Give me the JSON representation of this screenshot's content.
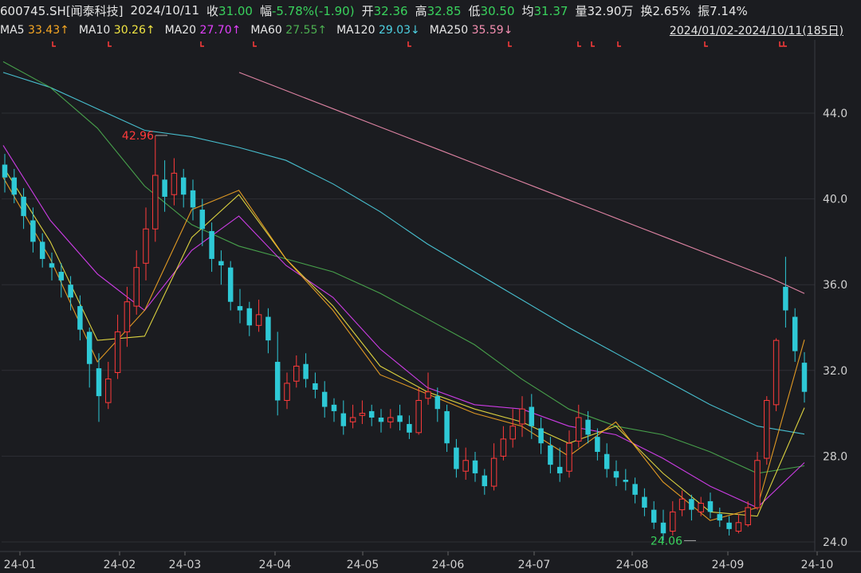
{
  "header": {
    "symbol": "600745.SH[闻泰科技]",
    "date": "2024/10/11",
    "close_label": "收",
    "close_value": "31.00",
    "change_label": "幅",
    "change_value": "-5.78%(-1.90)",
    "open_label": "开",
    "open_value": "32.36",
    "high_label": "高",
    "high_value": "32.85",
    "low_label": "低",
    "low_value": "30.50",
    "avg_label": "均",
    "avg_value": "31.37",
    "volume_label": "量",
    "volume_value": "32.90万",
    "turnover_label": "换",
    "turnover_value": "2.65%",
    "amplitude_label": "振",
    "amplitude_value": "7.14%"
  },
  "ma_legend": [
    {
      "label": "MA5",
      "value": "33.43↑",
      "color": "#f5a623"
    },
    {
      "label": "MA10",
      "value": "30.26↑",
      "color": "#f0e442"
    },
    {
      "label": "MA20",
      "value": "27.70↑",
      "color": "#e040fb"
    },
    {
      "label": "MA60",
      "value": "27.55↑",
      "color": "#4caf50"
    },
    {
      "label": "MA120",
      "value": "29.03↓",
      "color": "#4dd0e1"
    },
    {
      "label": "MA250",
      "value": "35.59↓",
      "color": "#f48fb1"
    }
  ],
  "date_range": "2024/01/02-2024/10/11(185日)",
  "colors": {
    "up": "#ff3b3b",
    "down": "#2ec9d6",
    "bg": "#1b1c20",
    "grid": "#2e2f35"
  },
  "chart_data": {
    "type": "candlestick",
    "title": "",
    "y_ticks": [
      "24.0",
      "28.0",
      "32.0",
      "36.0",
      "40.0",
      "44.0"
    ],
    "ylim": [
      23.5,
      47.0
    ],
    "x_ticks": [
      "24-01",
      "24-02",
      "24-03",
      "24-04",
      "24-05",
      "24-06",
      "24-07",
      "24-08",
      "24-09",
      "24-10"
    ],
    "annotations": [
      {
        "text": "42.96",
        "x": "24-03",
        "y": 42.96
      },
      {
        "text": "24.06",
        "x": "24-09",
        "y": 24.06
      }
    ],
    "moving_averages": [
      {
        "name": "MA250",
        "values": [
          45.9,
          45.3,
          44.7,
          44.1,
          43.5,
          42.9,
          42.3,
          41.7,
          41.1,
          40.5,
          39.9,
          39.3,
          38.7,
          38.1,
          37.5,
          36.9,
          36.3,
          35.59
        ]
      },
      {
        "name": "MA120",
        "values": [
          45.9,
          45.2,
          44.2,
          43.2,
          42.9,
          42.4,
          41.8,
          40.7,
          39.4,
          37.9,
          36.6,
          35.3,
          34.0,
          32.8,
          31.6,
          30.4,
          29.4,
          29.03
        ]
      },
      {
        "name": "MA60",
        "values": [
          46.4,
          45.2,
          43.3,
          40.6,
          38.8,
          37.8,
          37.2,
          36.6,
          35.6,
          34.4,
          33.2,
          31.6,
          30.2,
          29.4,
          29.0,
          28.2,
          27.2,
          27.55
        ]
      },
      {
        "name": "MA20",
        "values": [
          42.5,
          39.0,
          36.5,
          34.8,
          37.6,
          39.2,
          36.9,
          35.4,
          33.0,
          31.2,
          30.4,
          30.2,
          29.4,
          29.0,
          27.9,
          26.6,
          25.6,
          27.7
        ]
      },
      {
        "name": "MA10",
        "values": [
          41.5,
          38.0,
          33.4,
          33.6,
          38.2,
          40.2,
          37.2,
          35.0,
          32.2,
          31.0,
          30.2,
          29.6,
          28.6,
          29.4,
          27.2,
          25.4,
          25.2,
          30.26
        ]
      },
      {
        "name": "MA5",
        "values": [
          41.0,
          37.2,
          32.4,
          34.8,
          39.5,
          40.4,
          37.2,
          34.8,
          31.8,
          30.9,
          30.0,
          29.4,
          28.0,
          29.6,
          26.8,
          25.0,
          25.6,
          33.43
        ]
      }
    ],
    "candles": [
      [
        41.6,
        41.0,
        42.1,
        40.3
      ],
      [
        41.0,
        40.2,
        41.4,
        39.8
      ],
      [
        40.1,
        39.2,
        40.5,
        38.6
      ],
      [
        39.0,
        38.0,
        39.6,
        37.5
      ],
      [
        38.0,
        37.2,
        38.4,
        36.8
      ],
      [
        37.0,
        36.8,
        37.5,
        36.2
      ],
      [
        36.6,
        36.2,
        37.0,
        35.4
      ],
      [
        36.0,
        35.4,
        36.4,
        34.8
      ],
      [
        35.0,
        33.9,
        35.5,
        33.4
      ],
      [
        33.8,
        32.3,
        34.0,
        31.2
      ],
      [
        32.1,
        30.8,
        32.8,
        29.6
      ],
      [
        30.5,
        31.6,
        32.4,
        30.2
      ],
      [
        31.9,
        33.8,
        34.6,
        31.6
      ],
      [
        33.8,
        35.2,
        35.9,
        33.1
      ],
      [
        35.0,
        36.8,
        37.6,
        34.6
      ],
      [
        37.0,
        38.6,
        39.6,
        36.2
      ],
      [
        38.6,
        41.1,
        42.96,
        38.0
      ],
      [
        40.9,
        40.1,
        41.8,
        39.4
      ],
      [
        40.2,
        41.2,
        41.9,
        39.7
      ],
      [
        41.0,
        40.2,
        41.4,
        39.6
      ],
      [
        40.4,
        39.6,
        40.9,
        39.0
      ],
      [
        39.5,
        38.6,
        40.0,
        37.8
      ],
      [
        38.5,
        37.2,
        38.9,
        36.6
      ],
      [
        37.1,
        36.9,
        37.6,
        36.0
      ],
      [
        36.8,
        35.2,
        37.1,
        34.8
      ],
      [
        35.0,
        34.8,
        35.8,
        34.2
      ],
      [
        34.9,
        34.1,
        35.2,
        33.6
      ],
      [
        34.1,
        34.6,
        35.3,
        33.8
      ],
      [
        34.5,
        33.4,
        34.9,
        32.8
      ],
      [
        32.4,
        30.6,
        33.8,
        29.9
      ],
      [
        30.6,
        31.4,
        31.9,
        30.2
      ],
      [
        31.5,
        32.2,
        32.7,
        31.2
      ],
      [
        32.3,
        31.6,
        32.8,
        31.2
      ],
      [
        31.4,
        31.1,
        31.9,
        30.7
      ],
      [
        31.0,
        30.3,
        31.5,
        29.8
      ],
      [
        30.4,
        30.1,
        30.7,
        29.6
      ],
      [
        30.0,
        29.4,
        30.6,
        29.0
      ],
      [
        29.6,
        29.8,
        30.4,
        29.3
      ],
      [
        29.9,
        30.0,
        30.6,
        29.5
      ],
      [
        30.1,
        29.8,
        30.4,
        29.4
      ],
      [
        29.8,
        29.6,
        30.2,
        29.1
      ],
      [
        29.6,
        29.8,
        30.2,
        29.3
      ],
      [
        29.9,
        29.6,
        30.4,
        29.2
      ],
      [
        29.5,
        29.1,
        29.9,
        28.8
      ],
      [
        29.1,
        30.6,
        31.2,
        29.0
      ],
      [
        30.7,
        31.0,
        31.9,
        30.4
      ],
      [
        30.8,
        30.2,
        31.2,
        29.6
      ],
      [
        30.1,
        28.6,
        30.4,
        28.2
      ],
      [
        28.4,
        27.4,
        28.8,
        27.0
      ],
      [
        27.3,
        27.8,
        28.4,
        26.9
      ],
      [
        27.8,
        27.2,
        28.2,
        26.8
      ],
      [
        27.1,
        26.6,
        27.4,
        26.2
      ],
      [
        26.6,
        27.9,
        28.6,
        26.4
      ],
      [
        28.0,
        28.8,
        29.4,
        27.8
      ],
      [
        28.8,
        29.4,
        30.2,
        28.4
      ],
      [
        29.5,
        30.2,
        30.8,
        28.9
      ],
      [
        30.3,
        29.4,
        30.9,
        28.8
      ],
      [
        29.3,
        28.6,
        29.8,
        28.1
      ],
      [
        28.5,
        27.6,
        28.9,
        27.2
      ],
      [
        27.5,
        27.2,
        28.4,
        26.8
      ],
      [
        27.3,
        28.6,
        29.2,
        27.0
      ],
      [
        28.7,
        29.8,
        30.4,
        28.4
      ],
      [
        29.7,
        29.0,
        30.1,
        28.6
      ],
      [
        28.9,
        28.2,
        29.3,
        27.8
      ],
      [
        28.1,
        27.4,
        28.6,
        27.0
      ],
      [
        27.3,
        27.0,
        27.8,
        26.6
      ],
      [
        26.9,
        26.8,
        27.4,
        26.4
      ],
      [
        26.7,
        26.2,
        27.0,
        25.8
      ],
      [
        26.1,
        25.6,
        26.5,
        25.2
      ],
      [
        25.5,
        24.9,
        25.9,
        24.6
      ],
      [
        24.9,
        24.4,
        25.5,
        24.06
      ],
      [
        24.5,
        25.4,
        25.9,
        24.3
      ],
      [
        25.5,
        26.0,
        26.4,
        25.2
      ],
      [
        26.0,
        25.5,
        26.2,
        25.0
      ],
      [
        25.4,
        25.8,
        26.1,
        25.2
      ],
      [
        25.9,
        25.4,
        26.3,
        25.1
      ],
      [
        25.3,
        25.0,
        25.6,
        24.7
      ],
      [
        24.9,
        24.6,
        25.2,
        24.3
      ],
      [
        24.5,
        24.9,
        25.3,
        24.4
      ],
      [
        24.8,
        25.6,
        25.9,
        24.7
      ],
      [
        25.6,
        27.8,
        28.2,
        25.5
      ],
      [
        27.9,
        30.6,
        30.8,
        27.6
      ],
      [
        30.4,
        33.4,
        33.5,
        30.1
      ],
      [
        35.9,
        34.8,
        37.3,
        34.0
      ],
      [
        34.5,
        32.9,
        34.9,
        32.4
      ],
      [
        32.36,
        31.0,
        32.85,
        30.5
      ]
    ]
  }
}
